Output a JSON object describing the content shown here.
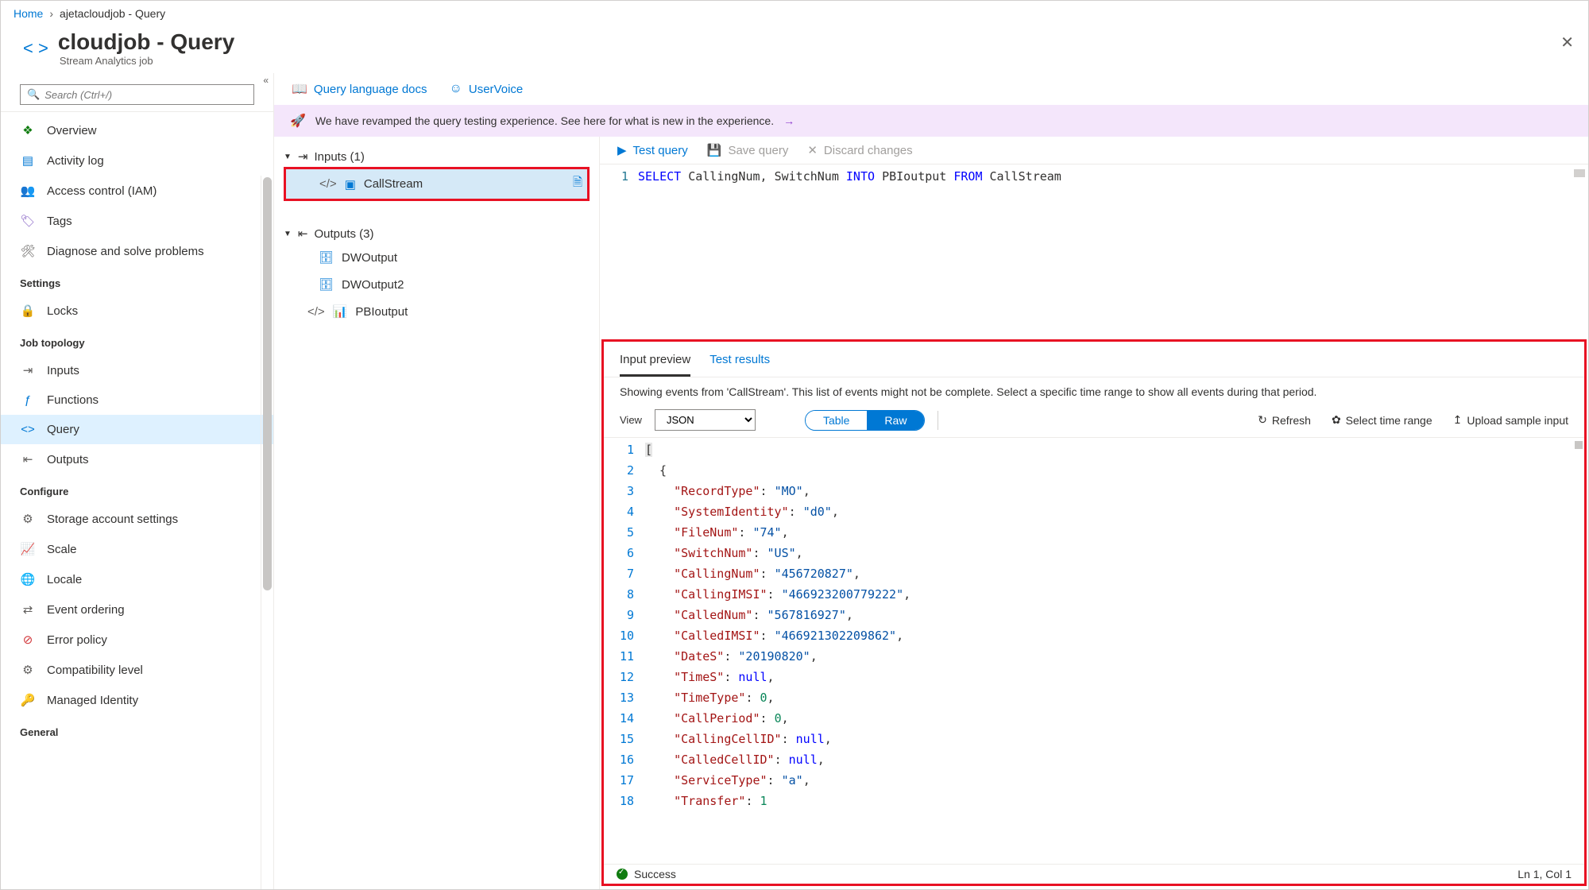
{
  "breadcrumb": {
    "home": "Home",
    "current": "ajetacloudjob - Query"
  },
  "header": {
    "title": "cloudjob - Query",
    "subtitle": "Stream Analytics job",
    "brackets": "< >"
  },
  "search": {
    "placeholder": "Search (Ctrl+/)"
  },
  "nav": {
    "top": [
      {
        "label": "Overview"
      },
      {
        "label": "Activity log"
      },
      {
        "label": "Access control (IAM)"
      },
      {
        "label": "Tags"
      },
      {
        "label": "Diagnose and solve problems"
      }
    ],
    "section_settings": "Settings",
    "settings": [
      {
        "label": "Locks"
      }
    ],
    "section_topology": "Job topology",
    "topology": [
      {
        "label": "Inputs"
      },
      {
        "label": "Functions"
      },
      {
        "label": "Query",
        "selected": true
      },
      {
        "label": "Outputs"
      }
    ],
    "section_configure": "Configure",
    "configure": [
      {
        "label": "Storage account settings"
      },
      {
        "label": "Scale"
      },
      {
        "label": "Locale"
      },
      {
        "label": "Event ordering"
      },
      {
        "label": "Error policy"
      },
      {
        "label": "Compatibility level"
      },
      {
        "label": "Managed Identity"
      }
    ],
    "section_general": "General"
  },
  "toolbar": {
    "docs": "Query language docs",
    "uservoice": "UserVoice"
  },
  "banner": {
    "text": "We have revamped the query testing experience. See here for what is new in the experience."
  },
  "tree": {
    "inputs_hdr": "Inputs (1)",
    "inputs": [
      {
        "label": "CallStream",
        "highlighted": true
      }
    ],
    "outputs_hdr": "Outputs (3)",
    "outputs": [
      {
        "label": "DWOutput"
      },
      {
        "label": "DWOutput2"
      },
      {
        "label": "PBIoutput"
      }
    ]
  },
  "editor_actions": {
    "test": "Test query",
    "save": "Save query",
    "discard": "Discard changes"
  },
  "code": {
    "line_no": "1",
    "tokens": {
      "select": "SELECT",
      "cols": "CallingNum, SwitchNum",
      "into": "INTO",
      "out": "PBIoutput",
      "from": "FROM",
      "src": "CallStream"
    }
  },
  "preview": {
    "tab_input": "Input preview",
    "tab_results": "Test results",
    "note": "Showing events from 'CallStream'. This list of events might not be complete. Select a specific time range to show all events during that period.",
    "view_label": "View",
    "view_value": "JSON",
    "toggle_table": "Table",
    "toggle_raw": "Raw",
    "refresh": "Refresh",
    "select_range": "Select time range",
    "upload": "Upload sample input"
  },
  "json_lines": [
    {
      "n": "1",
      "raw": "["
    },
    {
      "n": "2",
      "raw": "  {"
    },
    {
      "n": "3",
      "key": "RecordType",
      "vtype": "str",
      "val": "MO"
    },
    {
      "n": "4",
      "key": "SystemIdentity",
      "vtype": "str",
      "val": "d0"
    },
    {
      "n": "5",
      "key": "FileNum",
      "vtype": "str",
      "val": "74"
    },
    {
      "n": "6",
      "key": "SwitchNum",
      "vtype": "str",
      "val": "US"
    },
    {
      "n": "7",
      "key": "CallingNum",
      "vtype": "str",
      "val": "456720827"
    },
    {
      "n": "8",
      "key": "CallingIMSI",
      "vtype": "str",
      "val": "466923200779222"
    },
    {
      "n": "9",
      "key": "CalledNum",
      "vtype": "str",
      "val": "567816927"
    },
    {
      "n": "10",
      "key": "CalledIMSI",
      "vtype": "str",
      "val": "466921302209862"
    },
    {
      "n": "11",
      "key": "DateS",
      "vtype": "str",
      "val": "20190820"
    },
    {
      "n": "12",
      "key": "TimeS",
      "vtype": "null",
      "val": "null"
    },
    {
      "n": "13",
      "key": "TimeType",
      "vtype": "num",
      "val": "0"
    },
    {
      "n": "14",
      "key": "CallPeriod",
      "vtype": "num",
      "val": "0"
    },
    {
      "n": "15",
      "key": "CallingCellID",
      "vtype": "null",
      "val": "null"
    },
    {
      "n": "16",
      "key": "CalledCellID",
      "vtype": "null",
      "val": "null"
    },
    {
      "n": "17",
      "key": "ServiceType",
      "vtype": "str",
      "val": "a"
    },
    {
      "n": "18",
      "key": "Transfer",
      "vtype": "num",
      "val": "1",
      "partial": true
    }
  ],
  "status": {
    "text": "Success",
    "pos": "Ln 1, Col 1"
  }
}
